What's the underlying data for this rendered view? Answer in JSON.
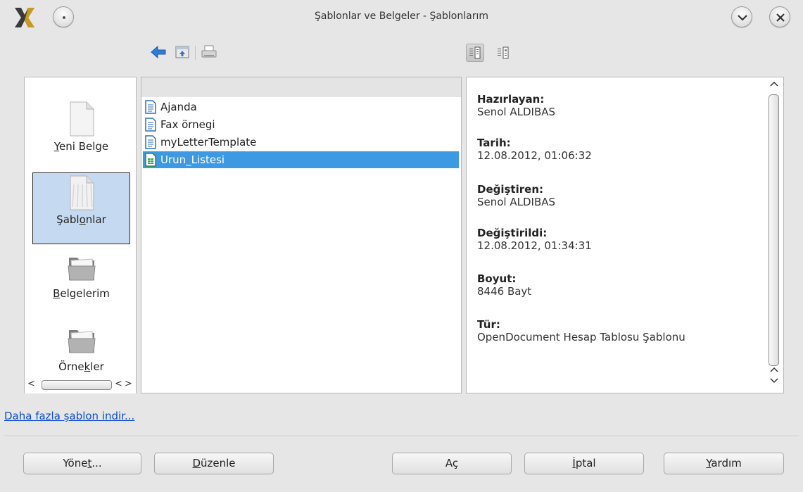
{
  "window": {
    "title": "Şablonlar ve Belgeler - Şablonlarım"
  },
  "categories": [
    {
      "pre": "",
      "mnemonic": "Y",
      "post": "eni Belge"
    },
    {
      "pre": "Şabl",
      "mnemonic": "o",
      "post": "nlar"
    },
    {
      "pre": "",
      "mnemonic": "B",
      "post": "elgelerim"
    },
    {
      "pre": "Örne",
      "mnemonic": "k",
      "post": "ler"
    }
  ],
  "files": [
    {
      "name": "Ajanda",
      "icon": "text-document-icon"
    },
    {
      "name": "Fax örnegi",
      "icon": "text-document-icon"
    },
    {
      "name": "myLetterTemplate",
      "icon": "text-document-icon"
    },
    {
      "name": "Urun_Listesi",
      "icon": "spreadsheet-icon",
      "selected": true
    }
  ],
  "info": [
    {
      "label": "Hazırlayan:",
      "value": "Senol ALDIBAS"
    },
    {
      "label": "Tarih:",
      "value": "12.08.2012, 01:06:32"
    },
    {
      "label": "Değiştiren:",
      "value": "Senol ALDIBAS"
    },
    {
      "label": "Değiştirildi:",
      "value": "12.08.2012, 01:34:31"
    },
    {
      "label": "Boyut:",
      "value": "8446 Bayt"
    },
    {
      "label": "Tür:",
      "value": "OpenDocument Hesap Tablosu Şablonu"
    }
  ],
  "download_link": "Daha fazla şablon indir...",
  "buttons": {
    "manage": {
      "pre": "Yöne",
      "mnemonic": "t",
      "post": "..."
    },
    "edit": {
      "pre": "",
      "mnemonic": "D",
      "post": "üzenle"
    },
    "open": {
      "pre": "Aç",
      "mnemonic": "",
      "post": ""
    },
    "cancel": {
      "pre": "",
      "mnemonic": "İ",
      "post": "ptal"
    },
    "help": {
      "pre": "",
      "mnemonic": "Y",
      "post": "ardım"
    }
  },
  "colors": {
    "selection": "#3d9ae2",
    "category_selected": "#c5daf0",
    "link": "#0a4bd6"
  }
}
